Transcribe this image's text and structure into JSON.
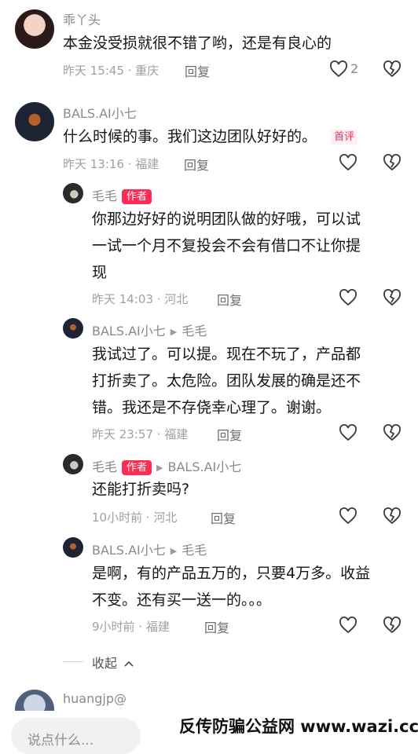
{
  "comments": [
    {
      "user": "乖丫头",
      "text": "本金没受损就很不错了哟，还是有良心的",
      "time": "昨天 15:45 · 重庆",
      "reply": "回复",
      "likes": "2"
    },
    {
      "user": "BALS.AI小七",
      "text": "什么时候的事。我们这边团队好好的。",
      "badge": "首评",
      "time": "昨天 13:16 · 福建",
      "reply": "回复"
    }
  ],
  "replies": [
    {
      "user": "毛毛",
      "author_badge": "作者",
      "text_lines": [
        "你那边好好的说明团队做的好哦，可以试",
        "一试一个月不复投会不会有借口不让你提",
        "现"
      ],
      "time": "昨天 14:03 · 河北",
      "reply": "回复"
    },
    {
      "user": "BALS.AI小七",
      "to": "毛毛",
      "text_lines": [
        "我试过了。可以提。现在不玩了，产品都",
        "打折卖了。太危险。团队发展的确是还不",
        "错。我还是不存侥幸心理了。谢谢。"
      ],
      "time": "昨天 23:57 · 福建",
      "reply": "回复"
    },
    {
      "user": "毛毛",
      "author_badge": "作者",
      "to": "BALS.AI小七",
      "text_lines": [
        "还能打折卖吗?"
      ],
      "time": "10小时前 · 河北",
      "reply": "回复"
    },
    {
      "user": "BALS.AI小七",
      "to": "毛毛",
      "text_lines": [
        "是啊，有的产品五万的，只要4万多。收益",
        "不变。还有买一送一的。。。"
      ],
      "time": "9小时前 · 福建",
      "reply": "回复"
    }
  ],
  "collapse_label": "收起",
  "next_user": "huangjp@",
  "input_placeholder": "说点什么...",
  "watermark": "反传防骗公益网 www.wazi.cc",
  "colors": {
    "accent": "#fe2c55",
    "meta": "#a0a0a0"
  },
  "icons": [
    "heart-icon",
    "dislike-heart-icon",
    "chevron-up-icon"
  ]
}
